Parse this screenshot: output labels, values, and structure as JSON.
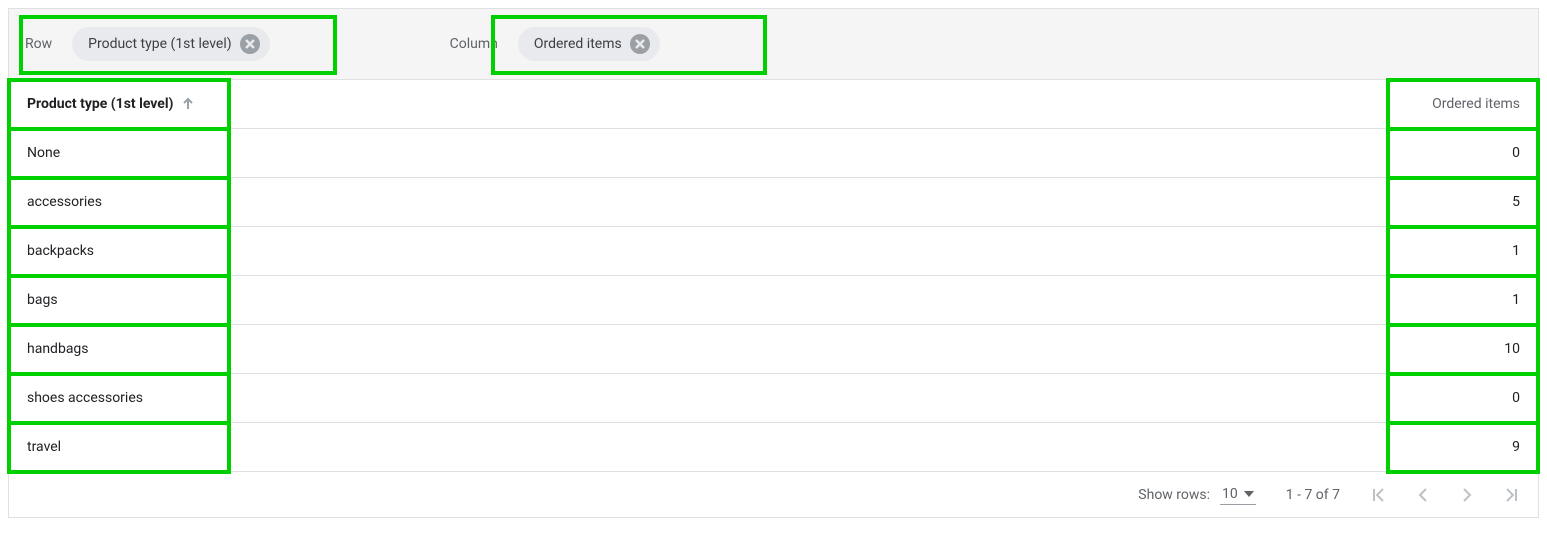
{
  "config": {
    "row_label": "Row",
    "row_chip": "Product type (1st level)",
    "column_label": "Column",
    "column_chip": "Ordered items"
  },
  "table": {
    "header_dimension": "Product type (1st level)",
    "header_metric": "Ordered items",
    "rows": [
      {
        "dim": "None",
        "val": "0"
      },
      {
        "dim": "accessories",
        "val": "5"
      },
      {
        "dim": "backpacks",
        "val": "1"
      },
      {
        "dim": "bags",
        "val": "1"
      },
      {
        "dim": "handbags",
        "val": "10"
      },
      {
        "dim": "shoes accessories",
        "val": "0"
      },
      {
        "dim": "travel",
        "val": "9"
      }
    ]
  },
  "footer": {
    "show_rows_label": "Show rows:",
    "page_size": "10",
    "range_text": "1 - 7 of 7"
  }
}
